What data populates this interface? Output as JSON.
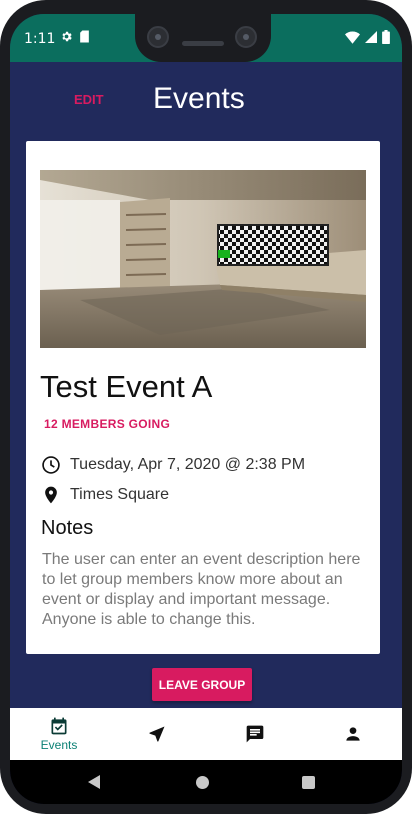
{
  "status_bar": {
    "time": "1:11"
  },
  "header": {
    "edit_label": "EDIT",
    "title": "Events"
  },
  "event": {
    "title": "Test Event A",
    "members_going": "12 MEMBERS GOING",
    "datetime": "Tuesday, Apr 7, 2020 @ 2:38 PM",
    "location": "Times Square",
    "notes_heading": "Notes",
    "notes_body": "The user can enter an event description here to let group members know more about an event or display and important message. Anyone is able to change this."
  },
  "actions": {
    "leave_group_label": "LEAVE GROUP"
  },
  "bottom_nav": {
    "items": [
      {
        "label": "Events",
        "icon": "calendar-check-icon",
        "active": true
      },
      {
        "label": "",
        "icon": "navigation-arrow-icon",
        "active": false
      },
      {
        "label": "",
        "icon": "chat-icon",
        "active": false
      },
      {
        "label": "",
        "icon": "person-icon",
        "active": false
      }
    ]
  },
  "colors": {
    "accent": "#d81b60",
    "header_background": "#212a5c",
    "status_bar": "#0b6e5e",
    "nav_active": "#0b8074"
  }
}
